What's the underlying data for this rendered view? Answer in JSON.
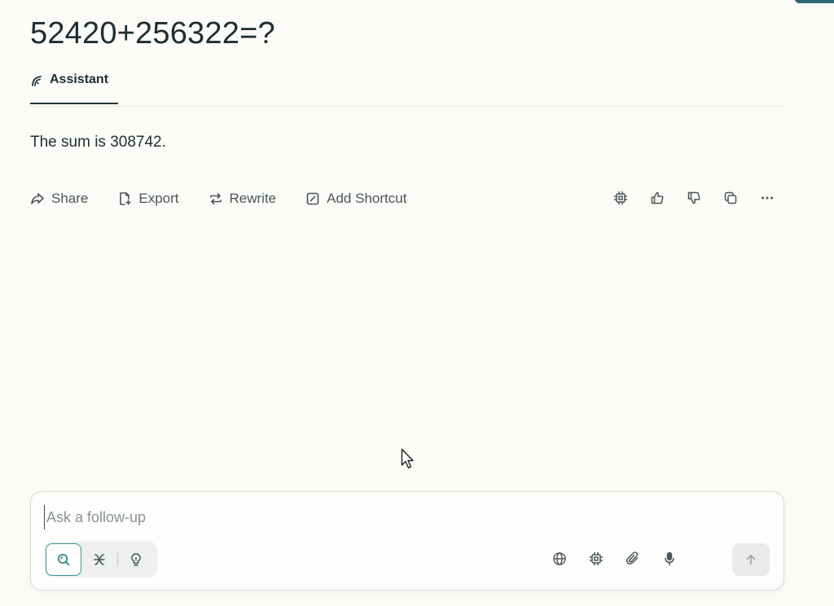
{
  "question": "52420+256322=?",
  "tab": {
    "label": "Assistant",
    "icon": "assistant-icon"
  },
  "answer": "The sum is 308742.",
  "actions": [
    {
      "label": "Share",
      "icon": "share-icon"
    },
    {
      "label": "Export",
      "icon": "export-icon"
    },
    {
      "label": "Rewrite",
      "icon": "rewrite-icon"
    },
    {
      "label": "Add Shortcut",
      "icon": "add-shortcut-icon"
    }
  ],
  "tools": [
    "model-chip-icon",
    "thumbs-up-icon",
    "thumbs-down-icon",
    "copy-icon",
    "more-icon"
  ],
  "composer": {
    "placeholder": "Ask a follow-up",
    "modes": [
      "search-mode-icon",
      "research-mode-icon",
      "reasoning-mode-icon"
    ],
    "tools": [
      "globe-icon",
      "model-chip-icon",
      "attach-icon",
      "microphone-icon"
    ],
    "send_icon": "arrow-up-icon"
  },
  "colors": {
    "background": "#fbfbf8",
    "text": "#1f2f33",
    "accent": "#3f8f95"
  }
}
